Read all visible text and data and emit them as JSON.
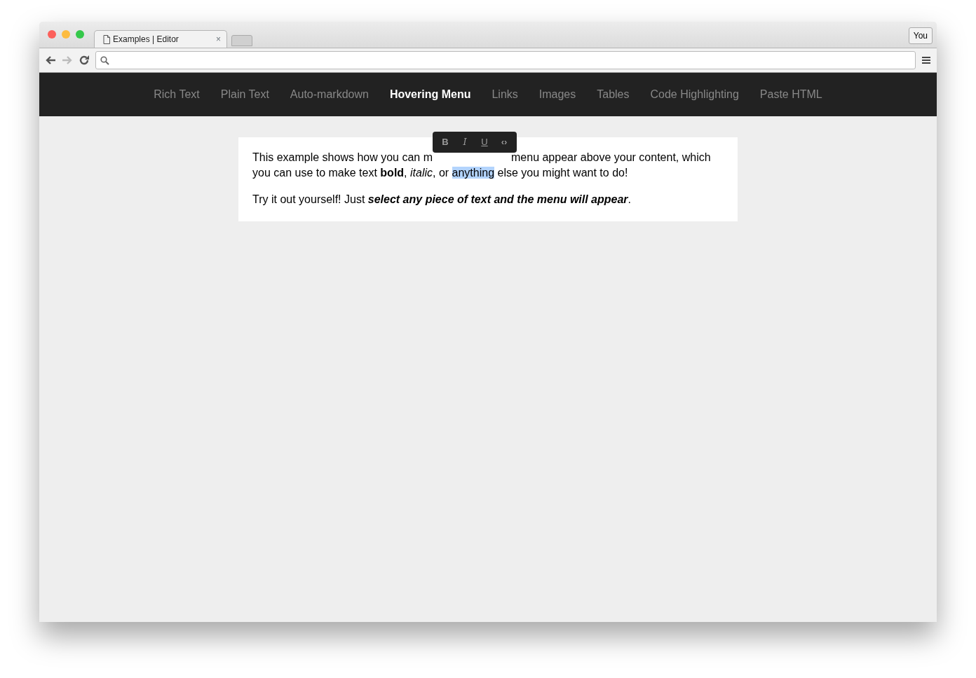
{
  "browser": {
    "tab": {
      "title": "Examples | Editor",
      "close": "×"
    },
    "profile_button": "You",
    "forward_disabled": true
  },
  "nav": [
    {
      "label": "Rich Text",
      "selected": false
    },
    {
      "label": "Plain Text",
      "selected": false
    },
    {
      "label": "Auto-markdown",
      "selected": false
    },
    {
      "label": "Hovering Menu",
      "selected": true
    },
    {
      "label": "Links",
      "selected": false
    },
    {
      "label": "Images",
      "selected": false
    },
    {
      "label": "Tables",
      "selected": false
    },
    {
      "label": "Code Highlighting",
      "selected": false
    },
    {
      "label": "Paste HTML",
      "selected": false
    }
  ],
  "hover_menu": [
    {
      "kind": "bold",
      "label": "B",
      "active": false
    },
    {
      "kind": "italic",
      "label": "I",
      "active": false
    },
    {
      "kind": "underline",
      "label": "U",
      "active": false
    },
    {
      "kind": "code",
      "label": "‹›",
      "active": false
    }
  ],
  "editor": {
    "before_menu": "This example shows how you can m",
    "after_menu": "menu appear above your content, which",
    "line_two": "you can use to make text **bold**, *italic*, or ",
    "selected_text": "anything",
    "after_selection": " else you might want to do!",
    "second_paragraph": "Try it out yourself! Just **select any piece of text and the menu will appear**."
  }
}
